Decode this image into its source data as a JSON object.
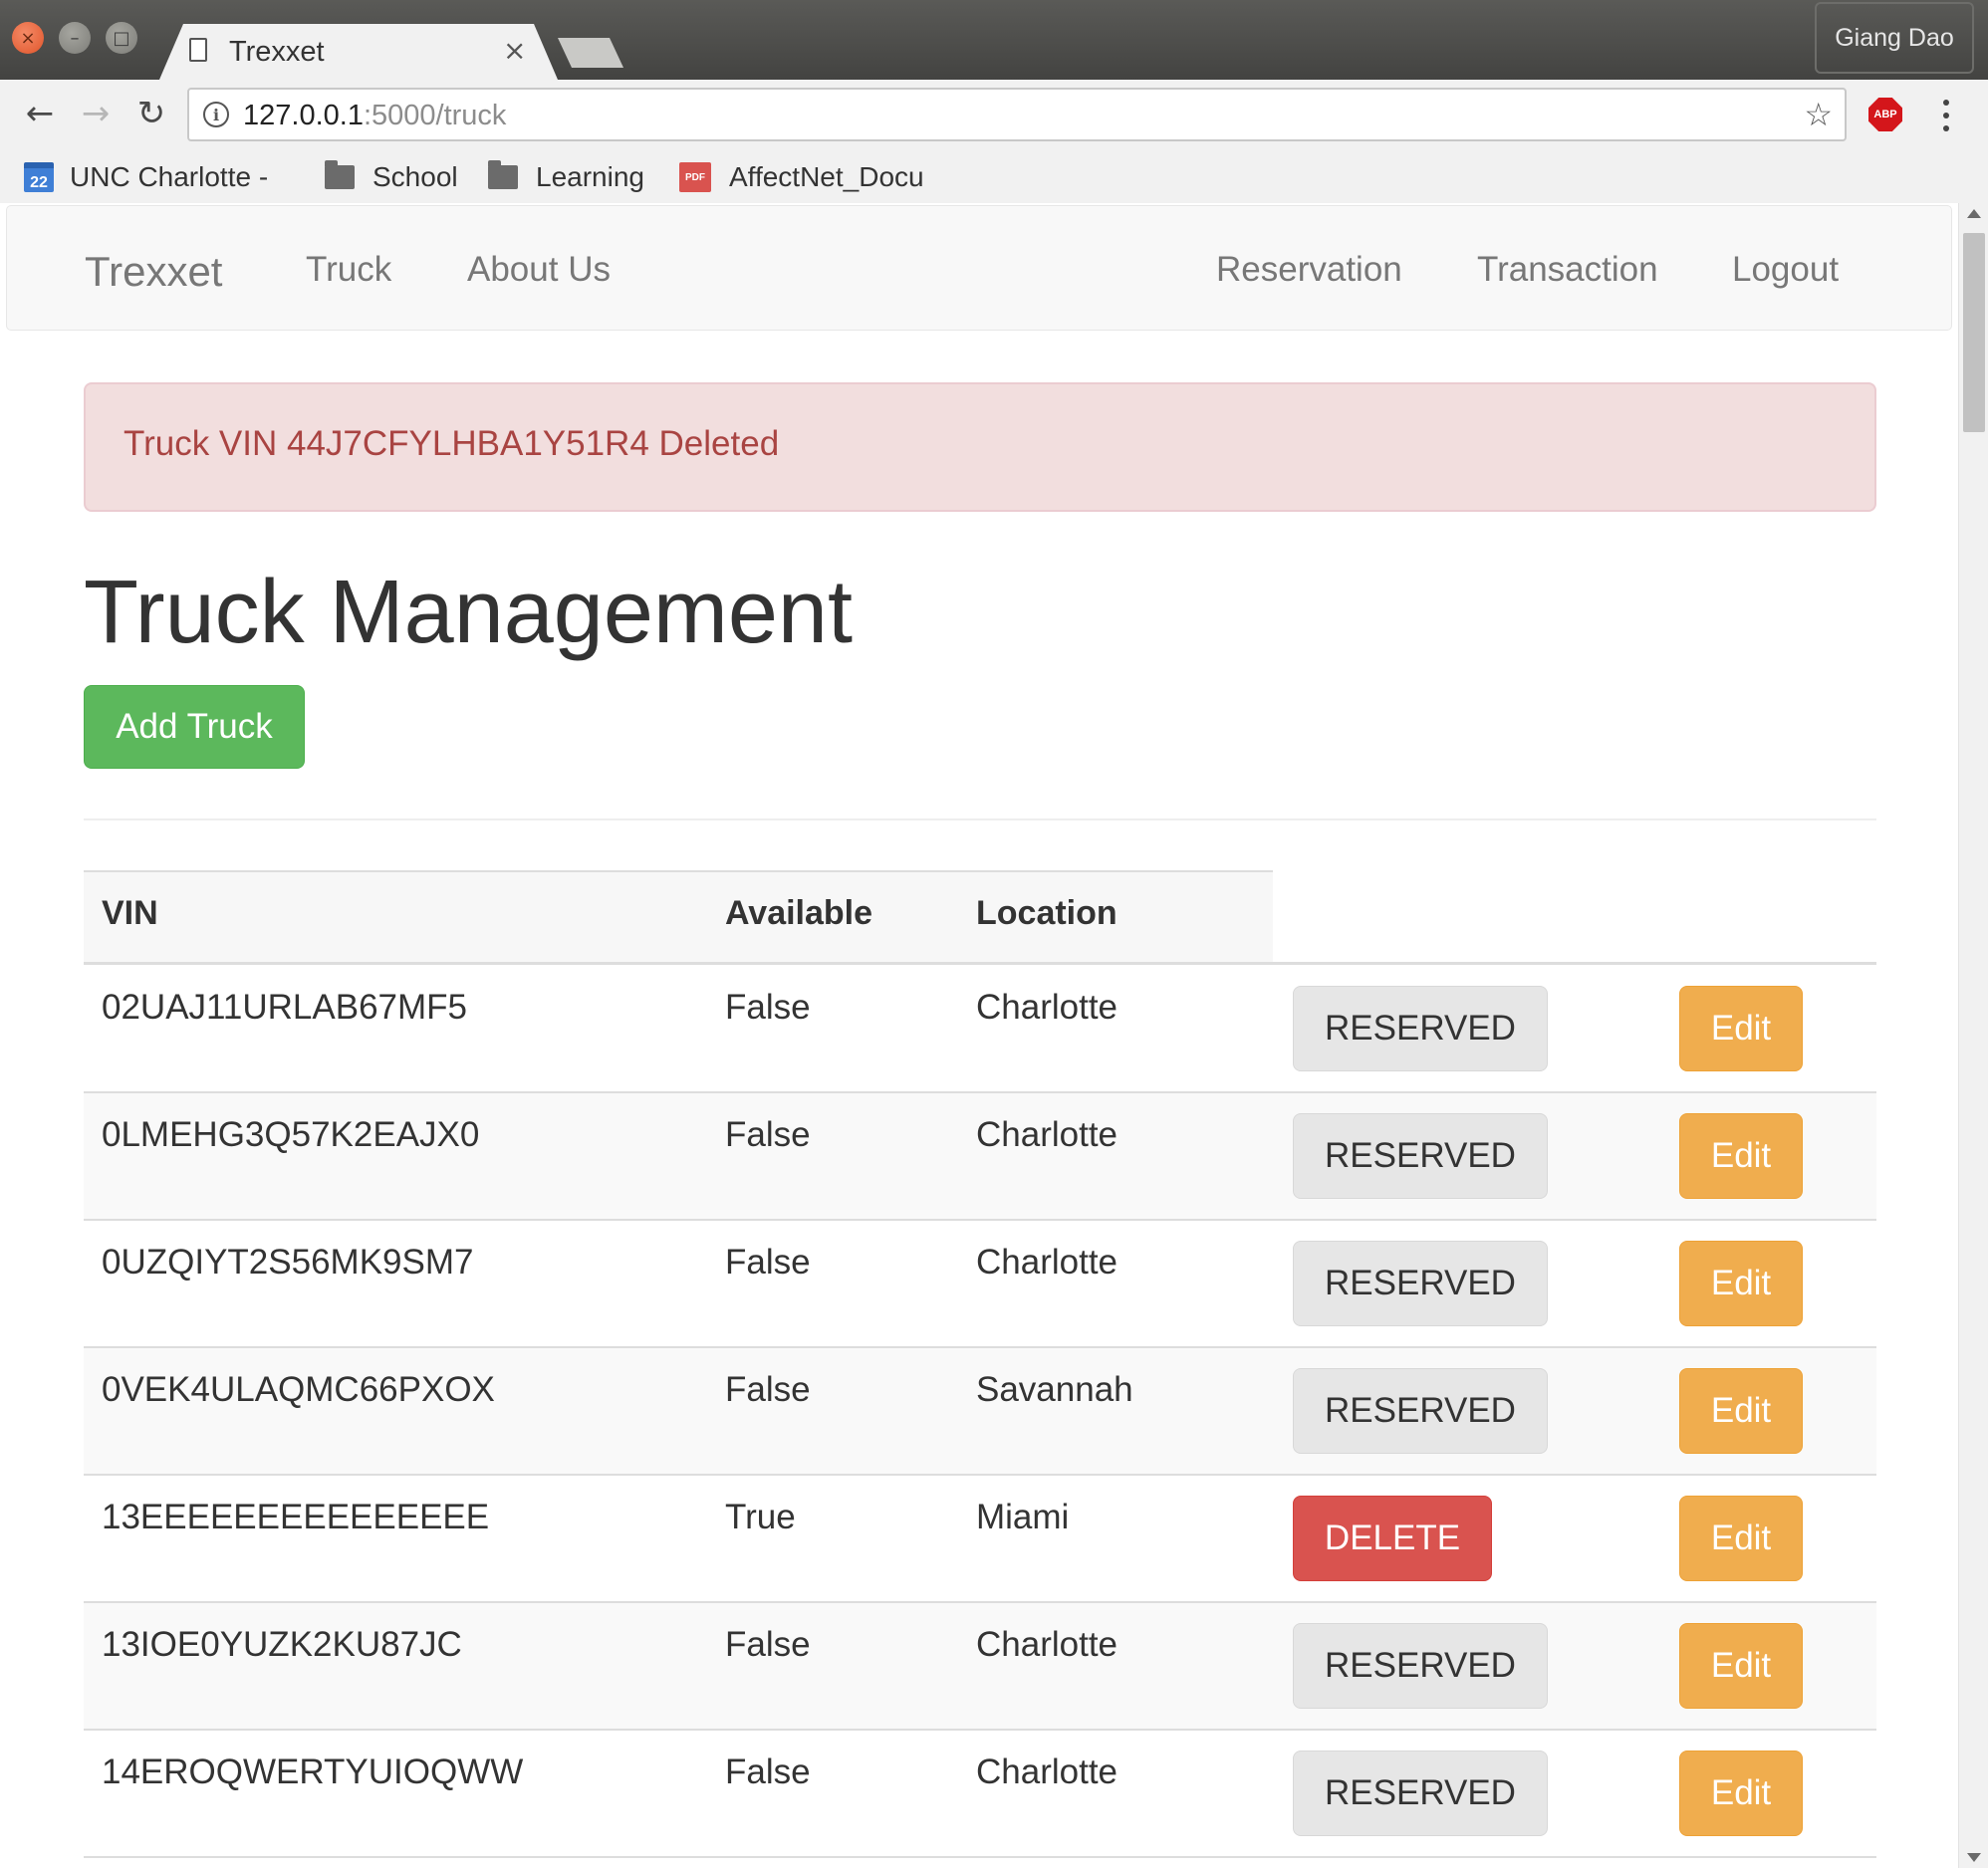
{
  "browser": {
    "tab_title": "Trexxet",
    "tab_close": "×",
    "profile_name": "Giang Dao",
    "url_host": "127.0.0.1",
    "url_rest": ":5000/truck",
    "abp_label": "ABP",
    "bookmarks": [
      {
        "label": "UNC Charlotte - ",
        "icon": "calendar-icon",
        "icon_text": "22"
      },
      {
        "label": "School",
        "icon": "folder-icon"
      },
      {
        "label": "Learning",
        "icon": "folder-icon"
      },
      {
        "label": "AffectNet_Docu",
        "icon": "pdf-icon",
        "icon_text": "PDF"
      }
    ]
  },
  "navbar": {
    "brand": "Trexxet",
    "left_links": [
      "Truck",
      "About Us"
    ],
    "right_links": [
      "Reservation",
      "Transaction",
      "Logout"
    ]
  },
  "alert": {
    "message": "Truck VIN 44J7CFYLHBA1Y51R4 Deleted"
  },
  "page": {
    "title": "Truck Management",
    "add_button": "Add Truck"
  },
  "table": {
    "headers": [
      "VIN",
      "Available",
      "Location"
    ],
    "rows": [
      {
        "vin": "02UAJ11URLAB67MF5",
        "available": "False",
        "location": "Charlotte",
        "action": "RESERVED",
        "edit": "Edit"
      },
      {
        "vin": "0LMEHG3Q57K2EAJX0",
        "available": "False",
        "location": "Charlotte",
        "action": "RESERVED",
        "edit": "Edit"
      },
      {
        "vin": "0UZQIYT2S56MK9SM7",
        "available": "False",
        "location": "Charlotte",
        "action": "RESERVED",
        "edit": "Edit"
      },
      {
        "vin": "0VEK4ULAQMC66PXOX",
        "available": "False",
        "location": "Savannah",
        "action": "RESERVED",
        "edit": "Edit"
      },
      {
        "vin": "13EEEEEEEEEEEEEEE",
        "available": "True",
        "location": "Miami",
        "action": "DELETE",
        "edit": "Edit"
      },
      {
        "vin": "13IOE0YUZK2KU87JC",
        "available": "False",
        "location": "Charlotte",
        "action": "RESERVED",
        "edit": "Edit"
      },
      {
        "vin": "14EROQWERTYUIOQWW",
        "available": "False",
        "location": "Charlotte",
        "action": "RESERVED",
        "edit": "Edit"
      }
    ]
  },
  "colors": {
    "success": "#5cb85c",
    "danger": "#d9534f",
    "warning": "#f0ad4e",
    "alert_bg": "#f2dede",
    "alert_text": "#a94442"
  }
}
